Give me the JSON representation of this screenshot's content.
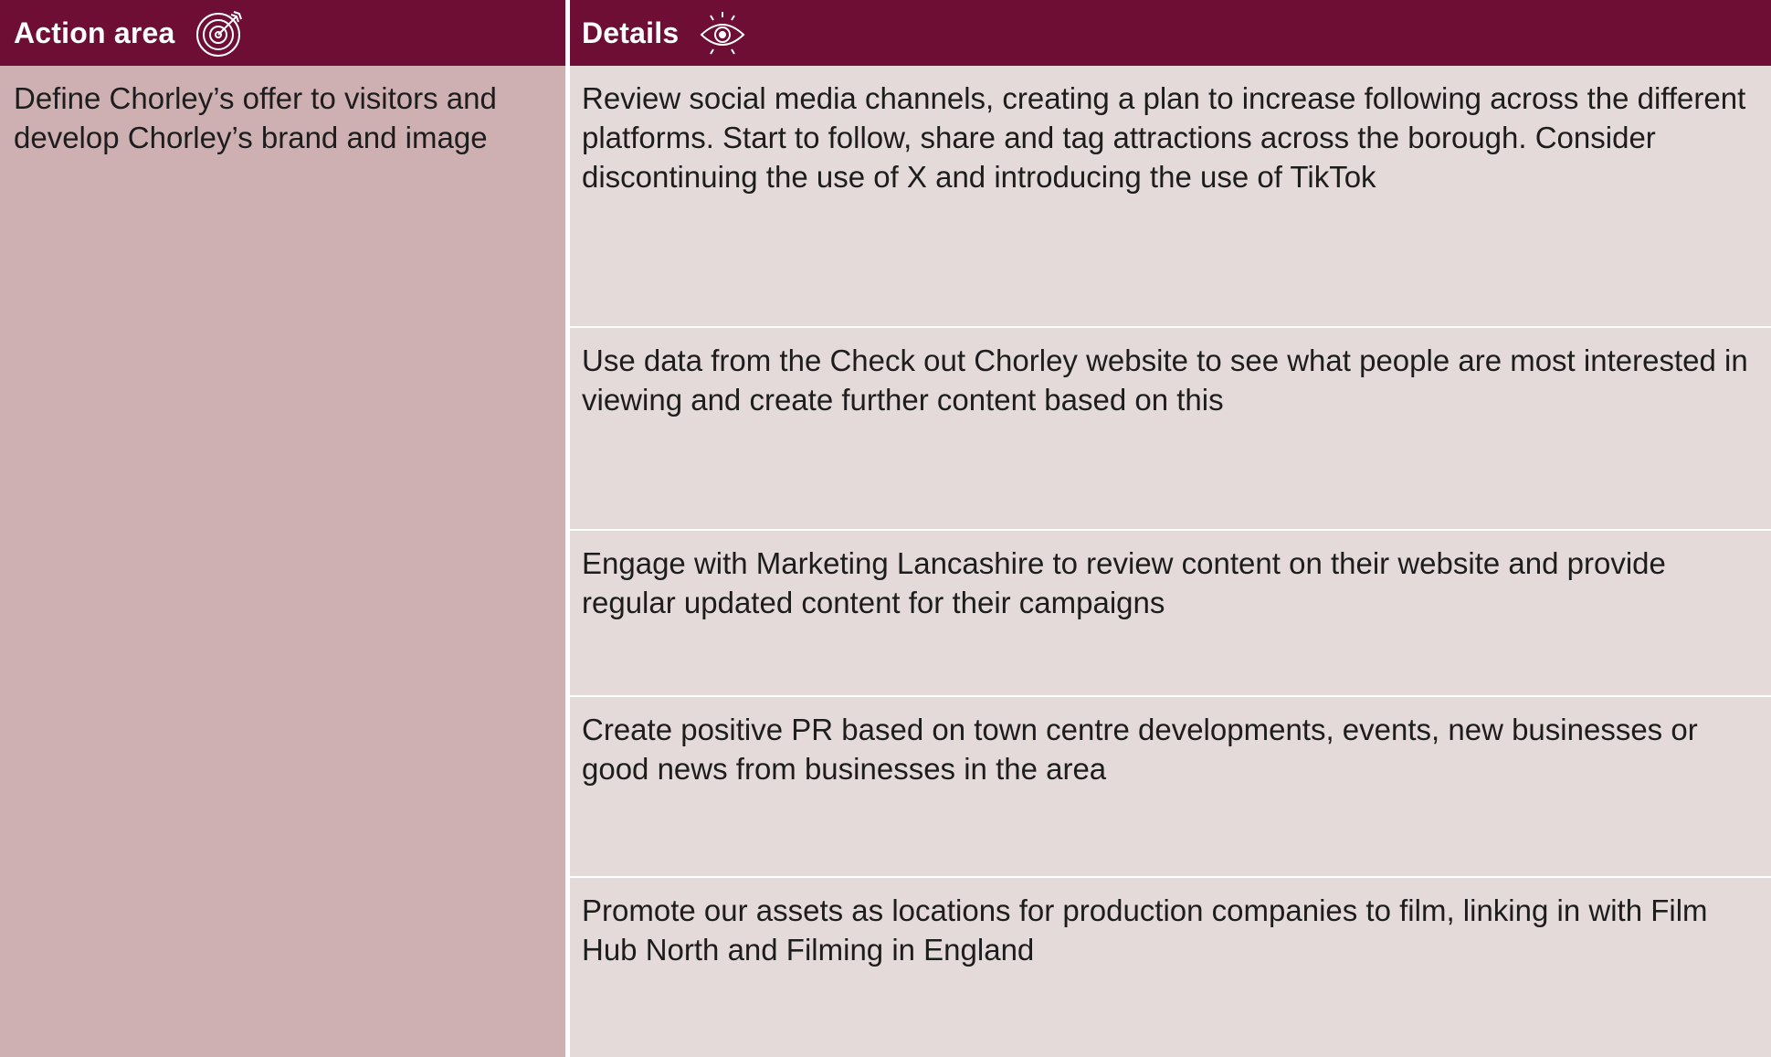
{
  "header": {
    "action_area_label": "Action area",
    "action_area_icon": "target-icon",
    "details_label": "Details",
    "details_icon": "eye-icon"
  },
  "action_area": {
    "text": "Define Chorley’s offer to visitors and develop Chorley’s brand and image"
  },
  "details": [
    {
      "text": "Review social media channels, creating a plan to increase following across the different platforms. Start to follow, share and tag attractions across the borough. Consider discontinuing the use of X and introducing the use of TikTok"
    },
    {
      "text": "Use data from the Check out Chorley website to see what people are most interested in viewing and create further content based on this"
    },
    {
      "text": "Engage with Marketing Lancashire to review content on their website and provide regular updated content for their campaigns"
    },
    {
      "text": "Create positive PR based on town centre developments, events, new businesses or good news from businesses in the area"
    },
    {
      "text": "Promote our assets as locations for production companies to film, linking in with Film Hub North and Filming in England"
    }
  ],
  "colors": {
    "header_bg": "#6e0e34",
    "left_column_bg": "#ceb0b3",
    "detail_row_bg": "#e5dada",
    "text": "#1d1d1d",
    "header_text": "#ffffff"
  }
}
